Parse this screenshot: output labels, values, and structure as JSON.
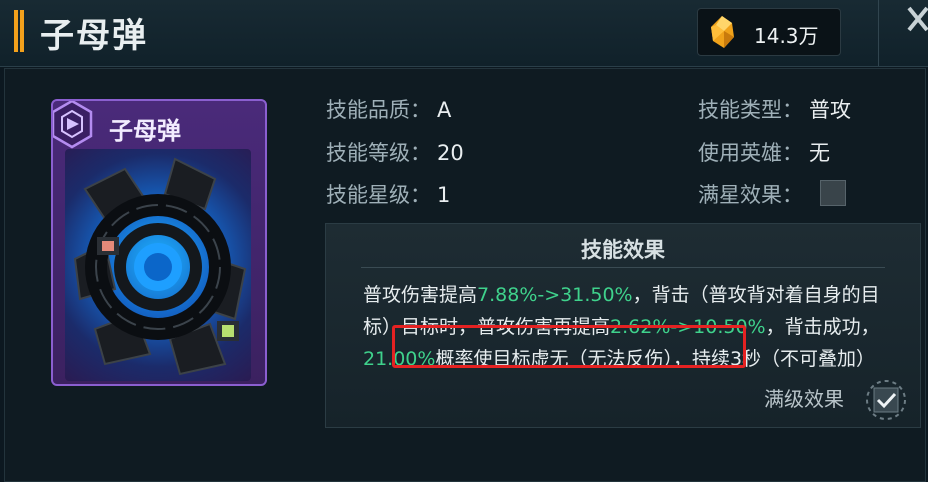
{
  "header": {
    "title": "子母弹",
    "currency_value": "14.3万"
  },
  "card": {
    "name": "子母弹",
    "frame_color": "#8b5fd0"
  },
  "stats_left": [
    {
      "label": "技能品质：",
      "value": "A"
    },
    {
      "label": "技能等级：",
      "value": "20"
    },
    {
      "label": "技能星级：",
      "value": "1"
    }
  ],
  "stats_right": [
    {
      "label": "技能类型：",
      "value": "普攻"
    },
    {
      "label": "使用英雄：",
      "value": "无"
    },
    {
      "label": "满星效果：",
      "value": ""
    }
  ],
  "effect": {
    "title": "技能效果",
    "seg1": "普攻伤害提高",
    "hl1": "7.88%->31.50%",
    "seg2": "，背击（普攻背对着自身的目标）目标时，普攻伤害再提高",
    "hl2": "2.62%->10.50%",
    "seg3": "，背击成功，",
    "hl3": "21.00%",
    "seg4": "概率使目标虚无（无法反伤），持续3秒（不可叠加）",
    "max_label": "满级效果",
    "max_checked": true
  },
  "colors": {
    "highlight": "#3fd28c",
    "accent": "#f3a11c",
    "annotation": "#e52222"
  }
}
